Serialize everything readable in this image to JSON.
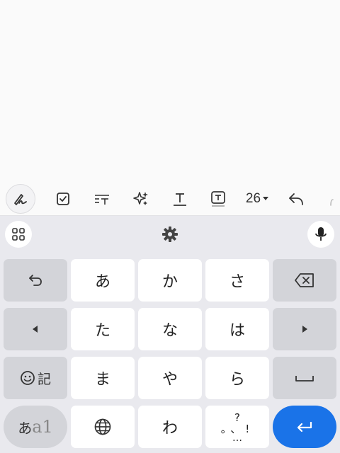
{
  "toolbar": {
    "font_size": "26",
    "items": [
      "handwriting-pen-icon",
      "checkbox-icon",
      "text-format-icon",
      "ai-sparkle-icon",
      "text-underline-icon",
      "text-box-icon",
      "font-size-select",
      "undo-icon"
    ]
  },
  "keyboard": {
    "keys": {
      "a": "あ",
      "ka": "か",
      "sa": "さ",
      "ta": "た",
      "na": "な",
      "ha": "は",
      "ma": "ま",
      "ya": "や",
      "ra": "ら",
      "wa": "わ",
      "emoji_kigou": "記",
      "mode_kana": "あ",
      "mode_alpha": "a1",
      "punct_top": "?",
      "punct_mid": "。、!",
      "punct_bottom": "…"
    }
  },
  "colors": {
    "keyboard_bg": "#e9e9ee",
    "key_white": "#ffffff",
    "key_gray": "#d3d4d9",
    "enter": "#1a73e8"
  }
}
